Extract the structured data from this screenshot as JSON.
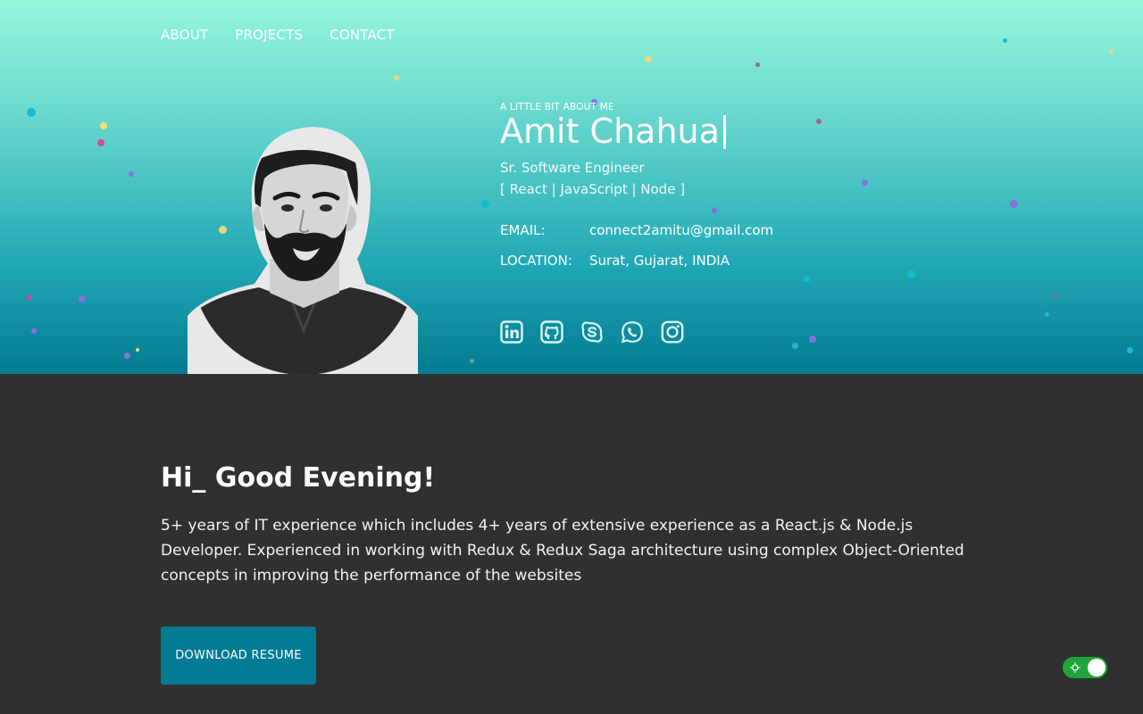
{
  "nav": {
    "items": [
      "ABOUT",
      "PROJECTS",
      "CONTACT"
    ]
  },
  "profile": {
    "eyebrow": "A LITTLE BIT ABOUT ME",
    "name": "Amit Chahua",
    "title": "Sr.  Software  Engineer",
    "stack": "[ React | JavaScript | Node ]",
    "email_label": "EMAIL:",
    "email": "connect2amitu@gmail.com",
    "location_label": "LOCATION:",
    "location": "Surat, Gujarat, INDIA"
  },
  "social": [
    "linkedin-icon",
    "github-icon",
    "skype-icon",
    "whatsapp-icon",
    "instagram-icon"
  ],
  "main": {
    "greeting": "Hi_ Good Evening!",
    "bio": "5+ years of IT experience which includes 4+ years of extensive experience as a React.js & Node.js Developer. Experienced in working with Redux & Redux Saga architecture using complex Object-Oriented concepts in improving the performance of the websites",
    "button": "DOWNLOAD RESUME"
  },
  "colors": {
    "hero_top": "#96f7db",
    "hero_bottom": "#037b92",
    "body_bg": "#303030",
    "button_bg": "#037b92",
    "toggle_bg": "#1fa43a"
  }
}
